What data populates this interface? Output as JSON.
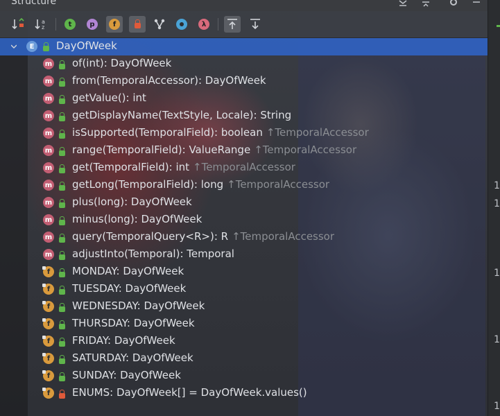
{
  "header": {
    "title": "Structure"
  },
  "toolbar": {
    "buttons": [
      {
        "name": "sort-by-visibility-button",
        "icon": "sort-visibility-icon"
      },
      {
        "name": "sort-alphabetically-button",
        "icon": "sort-alpha-icon",
        "glyph": "a"
      },
      {
        "name": "show-inherited-button",
        "icon": "inherited-icon",
        "glyph": "t"
      },
      {
        "name": "show-properties-button",
        "icon": "property-icon",
        "glyph": "p"
      },
      {
        "name": "show-fields-button",
        "icon": "field-icon",
        "glyph": "f"
      },
      {
        "name": "show-non-public-button",
        "icon": "lock-icon"
      },
      {
        "name": "group-methods-button",
        "icon": "fork-icon"
      },
      {
        "name": "show-anonymous-button",
        "icon": "anonymous-icon"
      },
      {
        "name": "show-lambdas-button",
        "icon": "lambda-icon",
        "glyph": "λ"
      },
      {
        "name": "autoscroll-to-source-button",
        "icon": "autoscroll-to-source-icon"
      },
      {
        "name": "autoscroll-from-source-button",
        "icon": "autoscroll-from-source-icon"
      }
    ]
  },
  "tree": {
    "root": {
      "kind": "E",
      "name": "DayOfWeek"
    },
    "items": [
      {
        "kind": "m",
        "text": "of(int): DayOfWeek",
        "inherited": ""
      },
      {
        "kind": "m",
        "text": "from(TemporalAccessor): DayOfWeek",
        "inherited": ""
      },
      {
        "kind": "m",
        "text": "getValue(): int",
        "inherited": ""
      },
      {
        "kind": "m",
        "text": "getDisplayName(TextStyle, Locale): String",
        "inherited": ""
      },
      {
        "kind": "m",
        "text": "isSupported(TemporalField): boolean",
        "inherited": "↑TemporalAccessor"
      },
      {
        "kind": "m",
        "text": "range(TemporalField): ValueRange",
        "inherited": "↑TemporalAccessor"
      },
      {
        "kind": "m",
        "text": "get(TemporalField): int",
        "inherited": "↑TemporalAccessor"
      },
      {
        "kind": "m",
        "text": "getLong(TemporalField): long",
        "inherited": "↑TemporalAccessor"
      },
      {
        "kind": "m",
        "text": "plus(long): DayOfWeek",
        "inherited": ""
      },
      {
        "kind": "m",
        "text": "minus(long): DayOfWeek",
        "inherited": ""
      },
      {
        "kind": "m",
        "text": "query(TemporalQuery<R>): R",
        "inherited": "↑TemporalAccessor"
      },
      {
        "kind": "m",
        "text": "adjustInto(Temporal): Temporal",
        "inherited": ""
      },
      {
        "kind": "f",
        "text": "MONDAY: DayOfWeek",
        "inherited": ""
      },
      {
        "kind": "f",
        "text": "TUESDAY: DayOfWeek",
        "inherited": ""
      },
      {
        "kind": "f",
        "text": "WEDNESDAY: DayOfWeek",
        "inherited": ""
      },
      {
        "kind": "f",
        "text": "THURSDAY: DayOfWeek",
        "inherited": ""
      },
      {
        "kind": "f",
        "text": "FRIDAY: DayOfWeek",
        "inherited": ""
      },
      {
        "kind": "f",
        "text": "SATURDAY: DayOfWeek",
        "inherited": ""
      },
      {
        "kind": "f",
        "text": "SUNDAY: DayOfWeek",
        "inherited": ""
      },
      {
        "kind": "f",
        "text": "ENUMS: DayOfWeek[] = DayOfWeek.values()",
        "inherited": ""
      }
    ]
  },
  "editor_gutter": {
    "digits": [
      "1",
      "1",
      "1",
      "1",
      "1"
    ]
  },
  "colors": {
    "selection": "#2f65ca",
    "method_icon": "#c35e73",
    "field_icon": "#d99a3d",
    "enum_icon": "#6b9bd9",
    "public_lock": "#5fb54b",
    "private_lock": "#e05a3a"
  }
}
